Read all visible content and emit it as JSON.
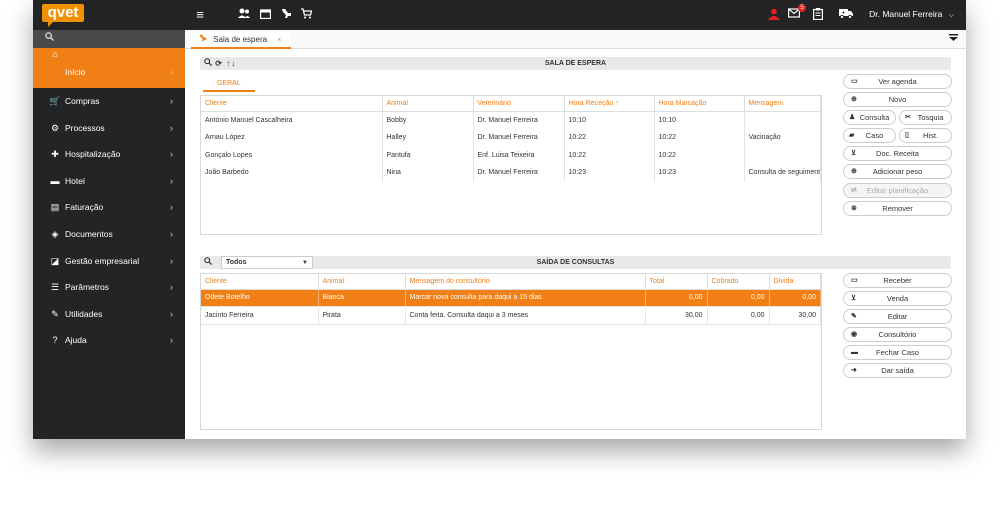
{
  "app": {
    "logo": "qvet",
    "user_name": "Dr. Manuel Ferreira",
    "user_chevron": "⌵",
    "notification_count": "5"
  },
  "topbar_icons": [
    "menu-icon",
    "users-icon",
    "calendar-icon",
    "pet-icon",
    "cart-icon"
  ],
  "sidebar": {
    "items": [
      {
        "label": "Início",
        "icon": "home-icon",
        "glyph": "⌂"
      },
      {
        "label": "Compras",
        "icon": "cart-icon",
        "glyph": "🛒"
      },
      {
        "label": "Processos",
        "icon": "gear-icon",
        "glyph": "⚙"
      },
      {
        "label": "Hospitalização",
        "icon": "medkit-icon",
        "glyph": "✚"
      },
      {
        "label": "Hotel",
        "icon": "bed-icon",
        "glyph": "▬"
      },
      {
        "label": "Faturação",
        "icon": "invoice-icon",
        "glyph": "▤"
      },
      {
        "label": "Documentos",
        "icon": "layers-icon",
        "glyph": "◈"
      },
      {
        "label": "Gestão empresarial",
        "icon": "chart-icon",
        "glyph": "◪"
      },
      {
        "label": "Parâmetros",
        "icon": "sliders-icon",
        "glyph": "☰"
      },
      {
        "label": "Utilidades",
        "icon": "wrench-icon",
        "glyph": "✎"
      },
      {
        "label": "Ajuda",
        "icon": "help-icon",
        "glyph": "?"
      }
    ]
  },
  "tab": {
    "label": "Sala de espera",
    "close": "×"
  },
  "waiting": {
    "title": "SALA DE ESPERA",
    "subtab": "GERAL",
    "columns": [
      "Cliente",
      "Animal",
      "Veterinário",
      "Hora Receção ↑",
      "Hora Marcação",
      "Mensagem"
    ],
    "rows": [
      [
        "António Manuel Cascalheira",
        "Bobby",
        "Dr. Manuel Ferreira",
        "10:10",
        "10:10",
        ""
      ],
      [
        "Arnau López",
        "Halley",
        "Dr. Manuel Ferreira",
        "10:22",
        "10:22",
        "Vacinação"
      ],
      [
        "Gonçalo Lopes",
        "Pantufa",
        "Enf. Luisa Teixeira",
        "10:22",
        "10:22",
        ""
      ],
      [
        "João Barbedo",
        "Nina",
        "Dr. Manuel Ferreira",
        "10:23",
        "10:23",
        "Consulta de seguimento"
      ]
    ],
    "buttons": {
      "ver_agenda": "Ver agenda",
      "novo": "Novo",
      "consulta": "Consulta",
      "tosquia": "Tosquia",
      "caso": "Caso",
      "hist": "Hist.",
      "doc_receita": "Doc. Receita",
      "adicionar_peso": "Adicionar peso",
      "editar_planificacao": "Editar planificação",
      "remover": "Remover"
    }
  },
  "exits": {
    "title": "SAÍDA DE CONSULTAS",
    "filter": "Todos",
    "columns": [
      "Cliente",
      "Animal",
      "Mensagem do consultório",
      "Total",
      "Cobrado",
      "Dívida"
    ],
    "rows": [
      [
        "Odete Botelho",
        "Bianca",
        "Marcar nova consulta para daqui a 15 dias",
        "0,00",
        "0,00",
        "0,00"
      ],
      [
        "Jacinto Ferreira",
        "Pirata",
        "Conta feita. Consulta daqui a 3 meses",
        "30,00",
        "0,00",
        "30,00"
      ]
    ],
    "buttons": {
      "receber": "Receber",
      "venda": "Venda",
      "editar": "Editar",
      "consultorio": "Consultório",
      "fechar_caso": "Fechar Caso",
      "dar_saida": "Dar saída"
    }
  },
  "colors": {
    "accent": "#f07f16",
    "dark": "#222426",
    "badge": "#e52222"
  }
}
